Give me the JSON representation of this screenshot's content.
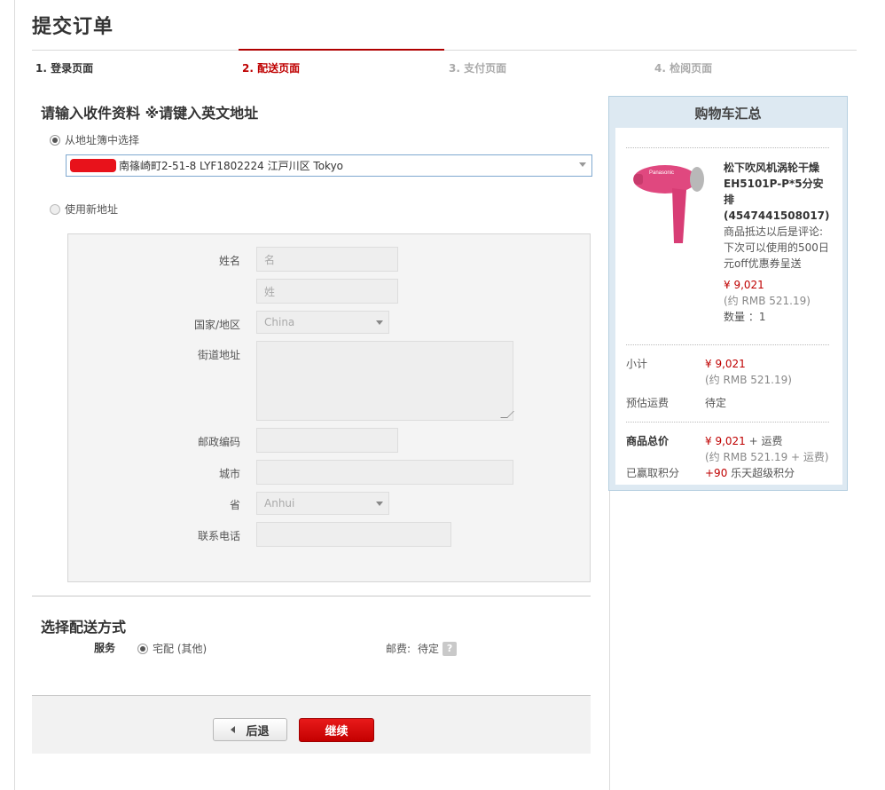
{
  "page_title": "提交订单",
  "steps": [
    {
      "label": "1. 登录页面"
    },
    {
      "label": "2. 配送页面"
    },
    {
      "label": "3. 支付页面"
    },
    {
      "label": "4. 检阅页面"
    }
  ],
  "address": {
    "heading": "请输入收件资料 ※请键入英文地址",
    "from_book_label": "从地址簿中选择",
    "selected_address": "南篠崎町2-51-8 LYF1802224 江戸川区 Tokyo",
    "new_address_label": "使用新地址"
  },
  "form": {
    "name_label": "姓名",
    "first_name_placeholder": "名",
    "last_name_placeholder": "姓",
    "country_label": "国家/地区",
    "country_value": "China",
    "street_label": "街道地址",
    "postal_label": "邮政编码",
    "city_label": "城市",
    "province_label": "省",
    "province_value": "Anhui",
    "phone_label": "联系电话"
  },
  "shipping": {
    "heading": "选择配送方式",
    "service_label": "服务",
    "option_label": "宅配 (其他)",
    "postage_label": "邮费:",
    "postage_value": "待定",
    "help_glyph": "?"
  },
  "actions": {
    "back_label": "后退",
    "continue_label": "继续"
  },
  "cart": {
    "title": "购物车汇总",
    "product_name": "松下吹风机涡轮干燥EH5101P-P*5分安排(4547441508017)",
    "promo": "商品抵达以后是评论:下次可以使用的500日元off优惠券呈送",
    "price": "¥ 9,021",
    "price_rmb": "(约 RMB 521.19)",
    "quantity": "数量 ：1",
    "subtotal_label": "小计",
    "subtotal_value": "¥ 9,021",
    "subtotal_rmb": "(约 RMB 521.19)",
    "shipping_est_label": "预估运费",
    "shipping_est_value": "待定",
    "total_label": "商品总价",
    "total_value": "¥ 9,021",
    "total_suffix": "+ 运费",
    "total_rmb": "(约 RMB 521.19 + 运费)",
    "points_label": "已赢取积分",
    "points_value": "+90",
    "points_suffix": "乐天超级积分"
  },
  "colors": {
    "accent_red": "#bf0000",
    "button_red": "#d00000",
    "product_pink": "#e0487f"
  }
}
